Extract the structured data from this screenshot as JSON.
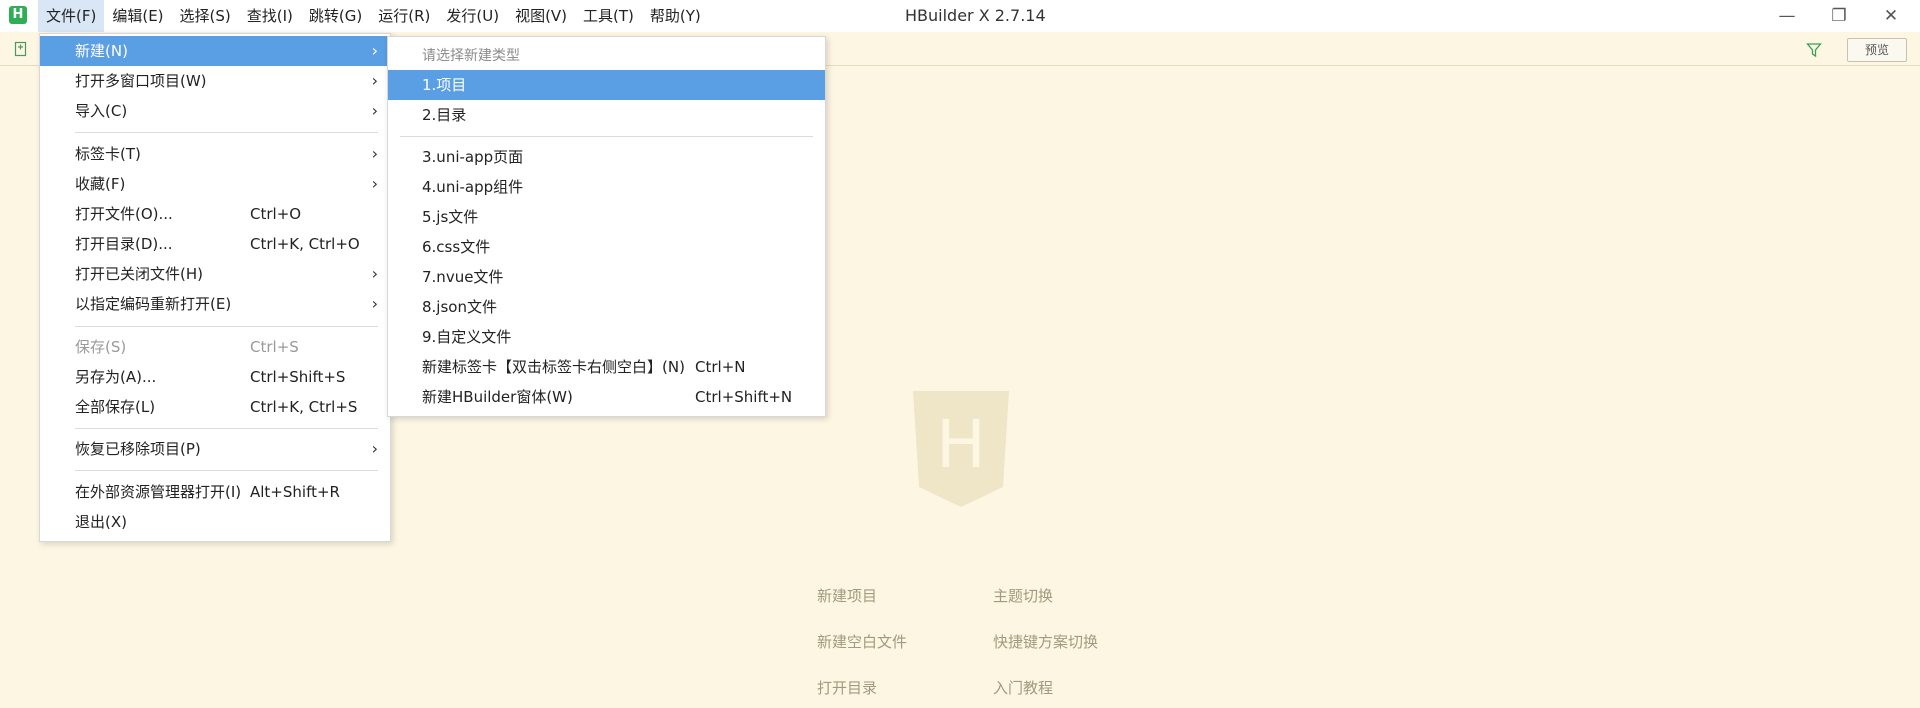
{
  "window": {
    "title": "HBuilder X 2.7.14",
    "minimize_glyph": "—",
    "maximize_glyph": "❐",
    "close_glyph": "✕"
  },
  "app_logo": "H",
  "menubar": [
    {
      "label": "文件(F)"
    },
    {
      "label": "编辑(E)"
    },
    {
      "label": "选择(S)"
    },
    {
      "label": "查找(I)"
    },
    {
      "label": "跳转(G)"
    },
    {
      "label": "运行(R)"
    },
    {
      "label": "发行(U)"
    },
    {
      "label": "视图(V)"
    },
    {
      "label": "工具(T)"
    },
    {
      "label": "帮助(Y)"
    }
  ],
  "toolbar": {
    "preview_label": "预览"
  },
  "file_menu": {
    "items": [
      {
        "label": "新建(N)",
        "shortcut": "",
        "arrow": "›"
      },
      {
        "label": "打开多窗口项目(W)",
        "shortcut": "",
        "arrow": "›"
      },
      {
        "label": "导入(C)",
        "shortcut": "",
        "arrow": "›"
      },
      {
        "label": "标签卡(T)",
        "shortcut": "",
        "arrow": "›"
      },
      {
        "label": "收藏(F)",
        "shortcut": "",
        "arrow": "›"
      },
      {
        "label": "打开文件(O)...",
        "shortcut": "Ctrl+O",
        "arrow": ""
      },
      {
        "label": "打开目录(D)...",
        "shortcut": "Ctrl+K, Ctrl+O",
        "arrow": ""
      },
      {
        "label": "打开已关闭文件(H)",
        "shortcut": "",
        "arrow": "›"
      },
      {
        "label": "以指定编码重新打开(E)",
        "shortcut": "",
        "arrow": "›"
      },
      {
        "label": "保存(S)",
        "shortcut": "Ctrl+S",
        "arrow": ""
      },
      {
        "label": "另存为(A)...",
        "shortcut": "Ctrl+Shift+S",
        "arrow": ""
      },
      {
        "label": "全部保存(L)",
        "shortcut": "Ctrl+K, Ctrl+S",
        "arrow": ""
      },
      {
        "label": "恢复已移除项目(P)",
        "shortcut": "",
        "arrow": "›"
      },
      {
        "label": "在外部资源管理器打开(I)",
        "shortcut": "Alt+Shift+R",
        "arrow": ""
      },
      {
        "label": "退出(X)",
        "shortcut": "",
        "arrow": ""
      }
    ]
  },
  "new_submenu": {
    "header": "请选择新建类型",
    "items": [
      {
        "label": "1.项目",
        "shortcut": ""
      },
      {
        "label": "2.目录",
        "shortcut": ""
      },
      {
        "label": "3.uni-app页面",
        "shortcut": ""
      },
      {
        "label": "4.uni-app组件",
        "shortcut": ""
      },
      {
        "label": "5.js文件",
        "shortcut": ""
      },
      {
        "label": "6.css文件",
        "shortcut": ""
      },
      {
        "label": "7.nvue文件",
        "shortcut": ""
      },
      {
        "label": "8.json文件",
        "shortcut": ""
      },
      {
        "label": "9.自定义文件",
        "shortcut": ""
      },
      {
        "label": "新建标签卡【双击标签卡右侧空白】(N)",
        "shortcut": "Ctrl+N"
      },
      {
        "label": "新建HBuilder窗体(W)",
        "shortcut": "Ctrl+Shift+N"
      }
    ]
  },
  "welcome": {
    "logo_letter": "H",
    "links": [
      "新建项目",
      "主题切换",
      "新建空白文件",
      "快捷键方案切换",
      "打开目录",
      "入门教程"
    ]
  },
  "colors": {
    "editor_bg": "#fdf6e3",
    "highlight": "#5a9ee3",
    "logo_green": "#2eaf55",
    "welcome_link": "#a09a7e"
  }
}
